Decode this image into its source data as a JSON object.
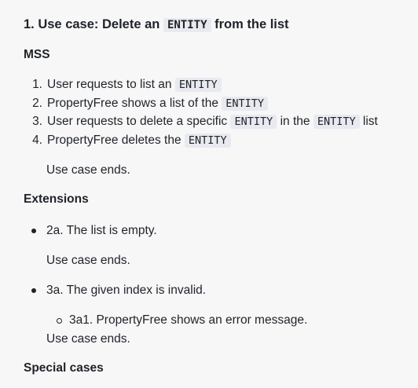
{
  "top_clipped_text": "~ ~ ~ ~ ~ ~ ~ ~ ~",
  "heading": {
    "prefix": "1. Use case: Delete an",
    "code": "ENTITY",
    "suffix": "from the list"
  },
  "mss": {
    "title": "MSS",
    "steps": [
      {
        "number": "1.",
        "parts": [
          "User requests to list an"
        ],
        "code1": "ENTITY"
      },
      {
        "number": "2.",
        "parts": [
          "PropertyFree shows a list of the"
        ],
        "code1": "ENTITY"
      },
      {
        "number": "3.",
        "parts": [
          "User requests to delete a specific",
          "in the",
          "list"
        ],
        "code1": "ENTITY",
        "code2": "ENTITY"
      },
      {
        "number": "4.",
        "parts": [
          "PropertyFree deletes the"
        ],
        "code1": "ENTITY"
      }
    ],
    "end": "Use case ends."
  },
  "extensions": {
    "title": "Extensions",
    "items": [
      {
        "text": "2a. The list is empty.",
        "end": "Use case ends."
      },
      {
        "text": "3a. The given index is invalid.",
        "sub": "3a1. PropertyFree shows an error message.",
        "end": "Use case ends."
      }
    ]
  },
  "special": {
    "title": "Special cases"
  }
}
